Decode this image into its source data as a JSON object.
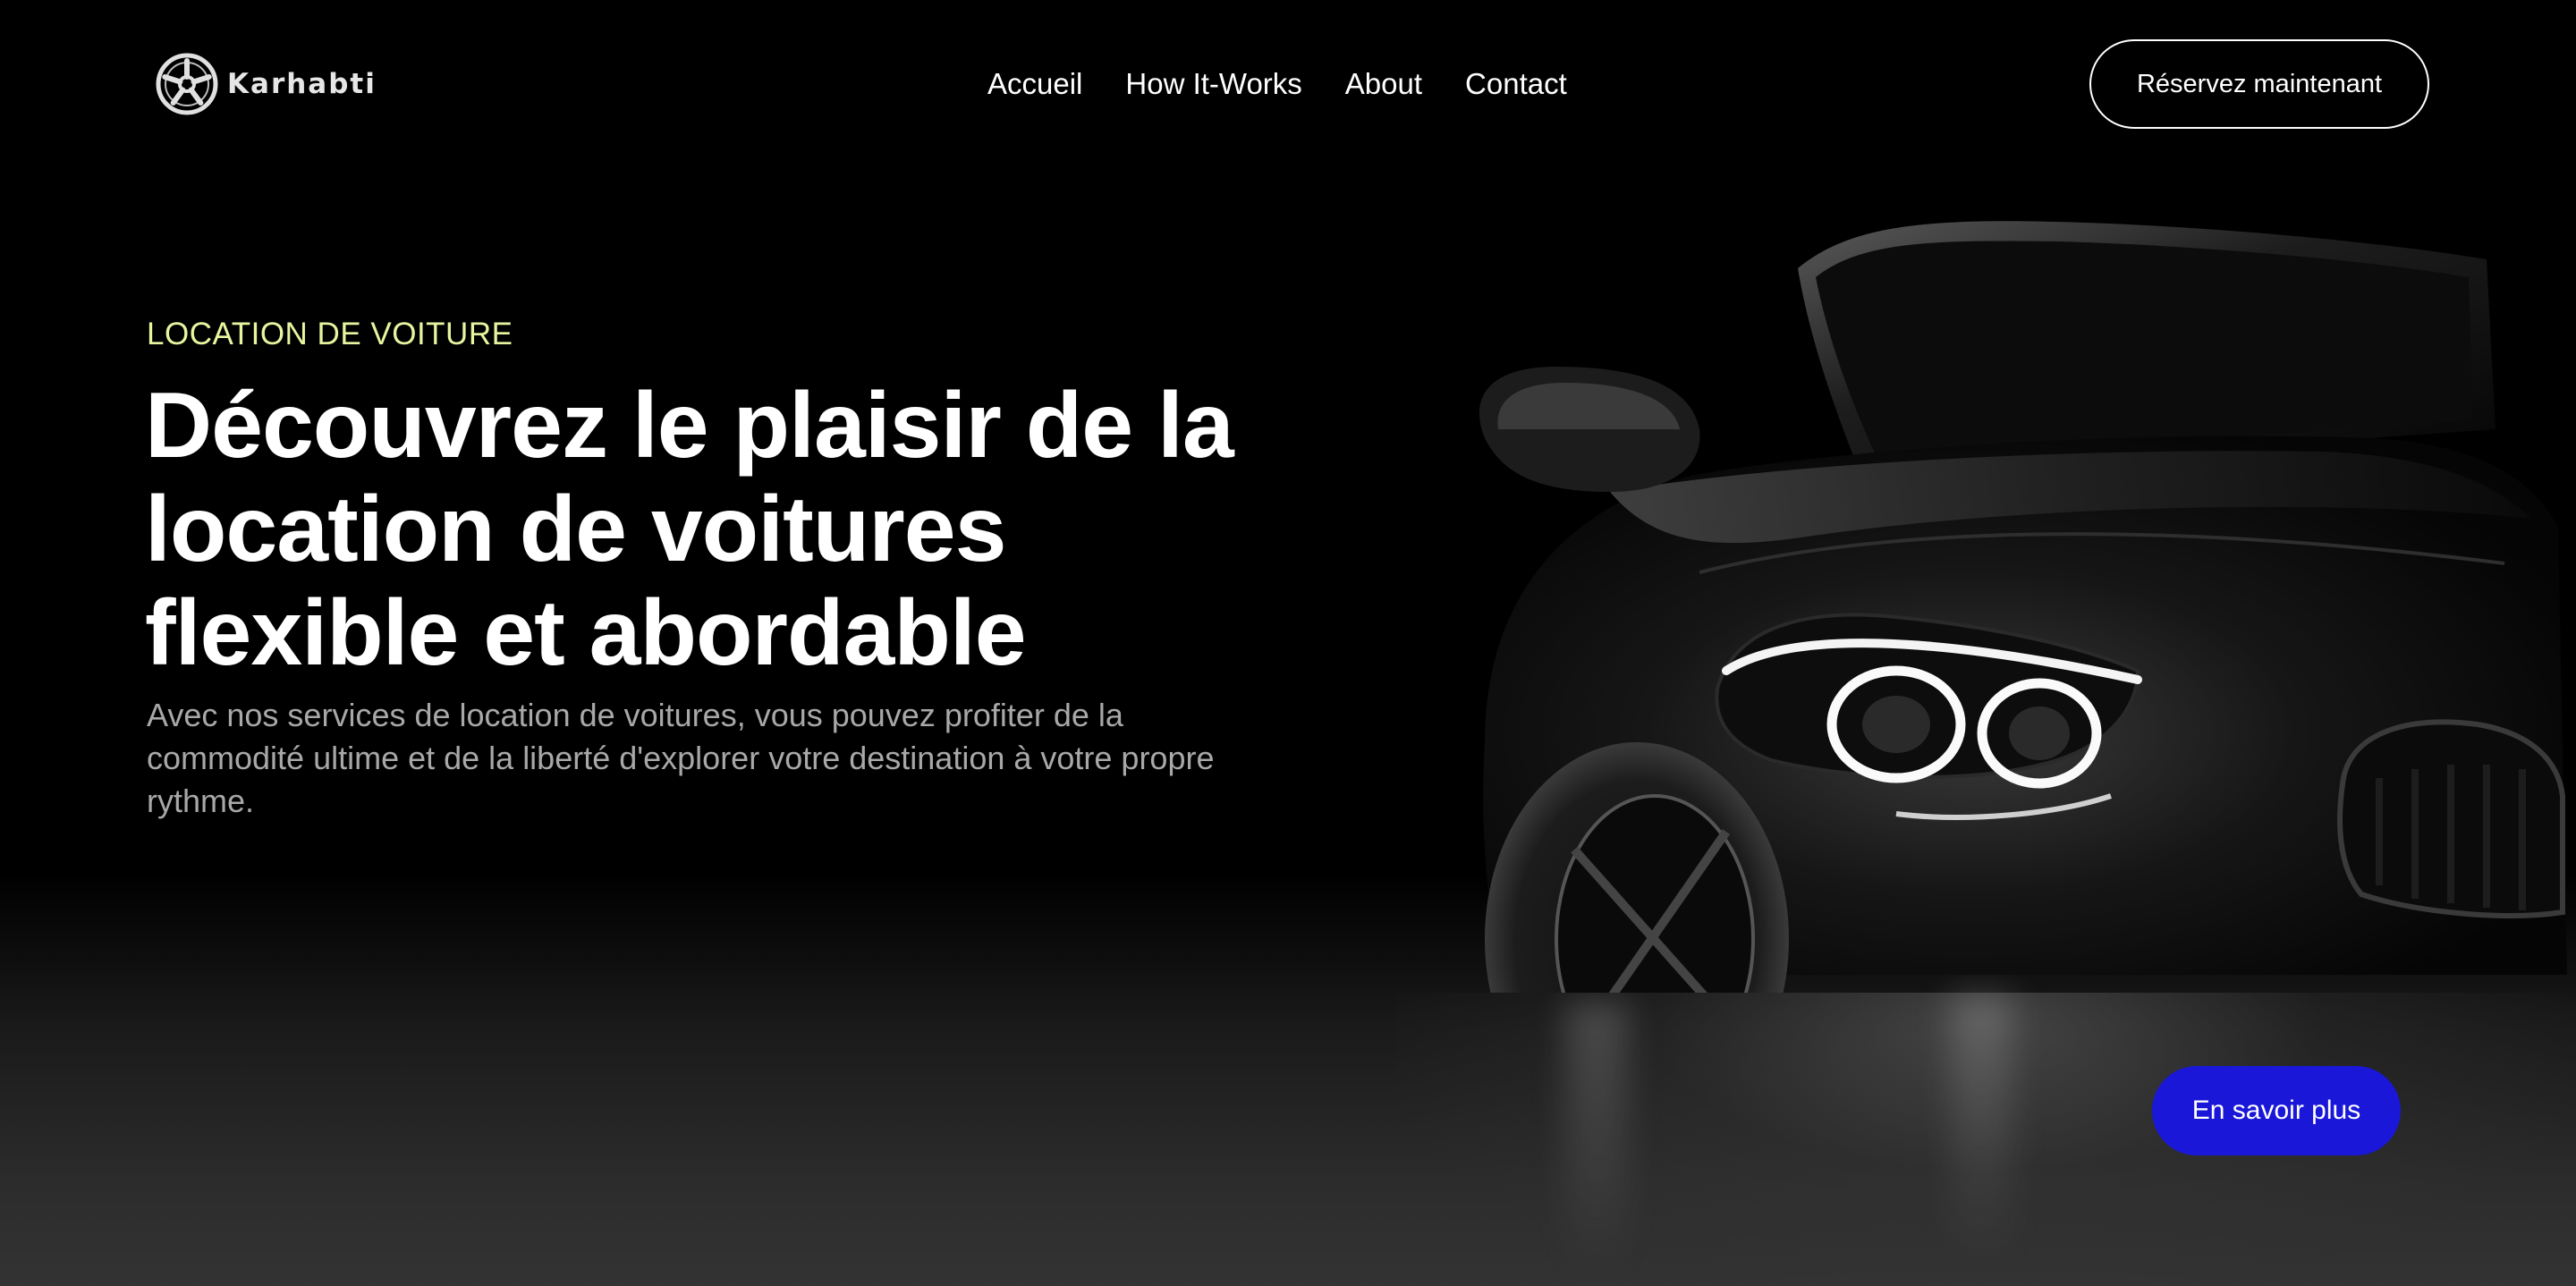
{
  "brand": {
    "name": "Karhabti",
    "logo_icon": "wheel-rim-icon"
  },
  "nav": {
    "items": [
      {
        "label": "Accueil"
      },
      {
        "label": "How It-Works"
      },
      {
        "label": "About"
      },
      {
        "label": "Contact"
      }
    ],
    "cta_label": "Réservez maintenant"
  },
  "hero": {
    "eyebrow": "LOCATION DE VOITURE",
    "headline_lines": [
      "Découvrez le plaisir de la",
      "location de voitures",
      "flexible et abordable"
    ],
    "description": "Avec nos services de location de voitures, vous pouvez profiter de la commodité ultime et de la liberté d'explorer votre destination à votre propre rythme.",
    "cta_label": "En savoir plus",
    "image": "black-sports-car-photo"
  },
  "colors": {
    "background": "#000000",
    "eyebrow": "#e8f5a0",
    "primary_button": "#1a17d9",
    "text_primary": "#ffffff",
    "text_secondary": "#a8a8a8"
  }
}
